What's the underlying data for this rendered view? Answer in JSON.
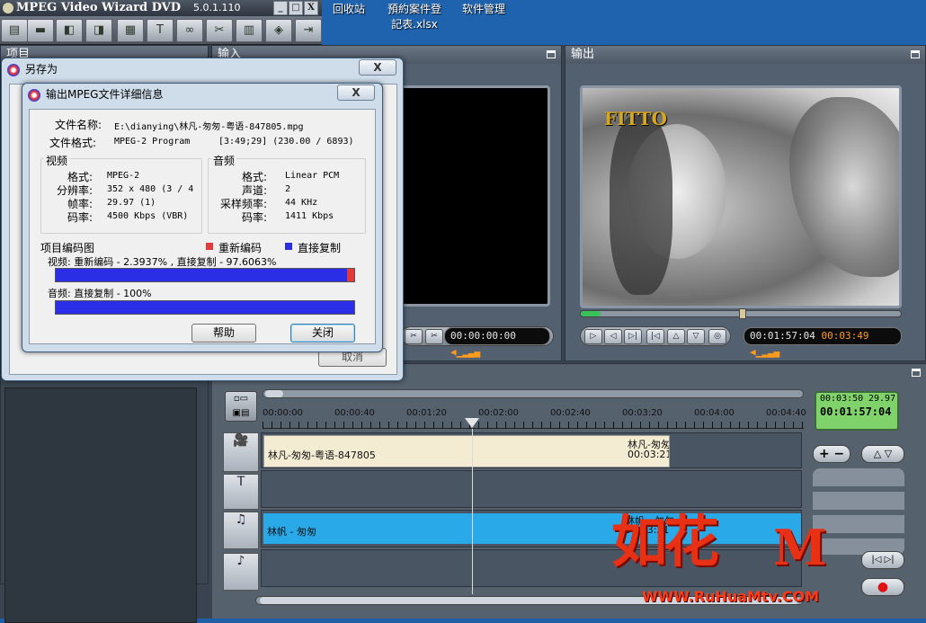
{
  "desktop": {
    "icons": [
      {
        "label": "回收站"
      },
      {
        "label": "預約案件登記表.xlsx"
      },
      {
        "label": "软件管理"
      }
    ]
  },
  "app": {
    "title": "MPEG Video Wizard DVD",
    "version": "5.0.1.110",
    "window_buttons": [
      "_",
      "□",
      "X"
    ]
  },
  "panels": {
    "project_label": "项目",
    "input_label": "输入",
    "output_label": "输出"
  },
  "preview": {
    "input_timecode": "00:00:00:00",
    "output_timecode": "00:01:57:04",
    "output_duration": "00:03:49",
    "output_overlay_text": "FITTO"
  },
  "timeline": {
    "ruler_ticks": [
      "00:00:00",
      "00:00:40",
      "00:01:20",
      "00:02:00",
      "00:02:40",
      "00:03:20",
      "00:04:00",
      "00:04:40"
    ],
    "video_clip_name": "林凡-匆匆-粤语-847805",
    "video_clip_end_label": "林凡-匆匆",
    "video_clip_end_time": "00:03:21",
    "audio_clip_name": "林帆 - 匆匆",
    "audio_clip_end_label": "林帆 - 匆匆",
    "audio_clip_end_time": "00:03:21",
    "counter_top_left": "00:03:50",
    "counter_top_right": "29.97",
    "counter_main": "00:01:57:04"
  },
  "save_dialog": {
    "title": "另存为",
    "close_label": "X",
    "cancel_label": "取消"
  },
  "info_dialog": {
    "title": "输出MPEG文件详细信息",
    "close_label": "X",
    "file_name_label": "文件名称:",
    "file_name_value": "E:\\dianying\\林凡-匆匆-粤语-847805.mpg",
    "file_format_label": "文件格式:",
    "file_format_value": "MPEG-2 Program",
    "file_format_extra": "[3:49;29] (230.00 / 6893)",
    "video_group": "视频",
    "video": [
      {
        "label": "格式:",
        "value": "MPEG-2"
      },
      {
        "label": "分辨率:",
        "value": "352 x 480 (3 / 4"
      },
      {
        "label": "帧率:",
        "value": "29.97 (1)"
      },
      {
        "label": "码率:",
        "value": "4500 Kbps (VBR)"
      }
    ],
    "audio_group": "音频",
    "audio": [
      {
        "label": "格式:",
        "value": "Linear PCM"
      },
      {
        "label": "声道:",
        "value": "2"
      },
      {
        "label": "采样频率:",
        "value": "44 KHz"
      },
      {
        "label": "码率:",
        "value": "1411 Kbps"
      }
    ],
    "chart_label": "项目编码图",
    "legend_reencode": "重新编码",
    "legend_copy": "直接复制",
    "video_summary": "视频: 重新编码 - 2.3937% ,  直接复制 - 97.6063%",
    "audio_summary": "音频: 直接复制 - 100%",
    "video_reencode_percent": 2.3937,
    "video_copy_percent": 97.6063,
    "audio_copy_percent": 100,
    "help_label": "帮助",
    "ok_label": "关闭",
    "colors": {
      "reencode": "#e03a3a",
      "copy": "#2a2ee6"
    }
  },
  "watermark": {
    "brand": "如花",
    "url": "WWW.RuHuaMtv.COM"
  }
}
